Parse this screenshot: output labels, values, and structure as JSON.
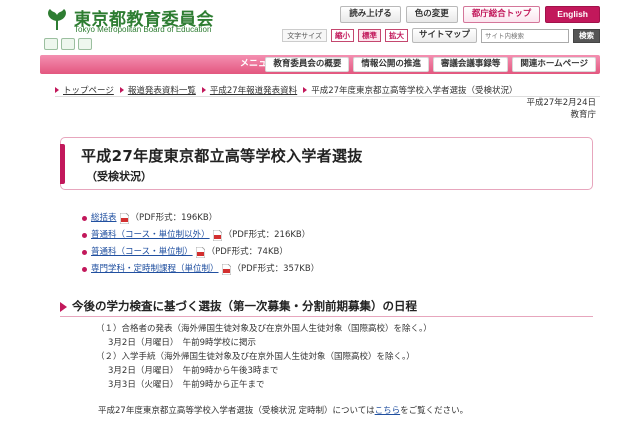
{
  "header": {
    "logo_jp": "東京都教育委員会",
    "logo_en": "Tokyo Metropolitan Board of Education",
    "buttons": {
      "read_aloud": "読み上げる",
      "color_change": "色の変更",
      "metro_top": "都庁総合トップ",
      "english": "English"
    },
    "text_size_label": "文字サイズ",
    "text_size_small": "縮小",
    "text_size_normal": "標準",
    "text_size_large": "拡大",
    "sitemap": "サイトマップ",
    "search_placeholder": "サイト内検索",
    "search_button": "検索"
  },
  "nav": {
    "menu_label": "メニュー",
    "items": [
      "教育委員会の概要",
      "情報公開の推進",
      "審議会議事録等",
      "関連ホームページ"
    ]
  },
  "breadcrumb": {
    "items": [
      "トップページ",
      "報道発表資料一覧",
      "平成27年報道発表資料"
    ],
    "current": "平成27年度東京都立高等学校入学者選抜（受検状況）"
  },
  "date": {
    "line1": "平成27年2月24日",
    "line2": "教育庁"
  },
  "title": {
    "main": "平成27年度東京都立高等学校入学者選抜",
    "sub": "（受検状況）"
  },
  "files": [
    {
      "label": "総括表",
      "meta": "（PDF形式：196KB）"
    },
    {
      "label": "普通科（コース・単位制以外）",
      "meta": "（PDF形式：216KB）"
    },
    {
      "label": "普通科（コース・単位制）",
      "meta": "（PDF形式：74KB）"
    },
    {
      "label": "専門学科・定時制課程（単位制）",
      "meta": "（PDF形式：357KB）"
    }
  ],
  "section": {
    "heading": "今後の学力検査に基づく選抜（第一次募集・分割前期募集）の日程",
    "lines": [
      "（１）合格者の発表（海外帰国生徒対象及び在京外国人生徒対象（国際高校）を除く。）",
      "3月2日（月曜日）　午前9時学校に掲示",
      "（２）入学手続（海外帰国生徒対象及び在京外国人生徒対象（国際高校）を除く。）",
      "3月2日（月曜日）　午前9時から午後3時まで",
      "3月3日（火曜日）　午前9時から正午まで"
    ]
  },
  "note": {
    "before": "平成27年度東京都立高等学校入学者選抜（受検状況 定時制）については",
    "link": "こちら",
    "after": "をご覧ください。"
  },
  "colors": {
    "brand_green": "#2e7d32",
    "accent_pink": "#c2185b",
    "nav_pink": "#e3577f",
    "link_blue": "#2150a0"
  }
}
